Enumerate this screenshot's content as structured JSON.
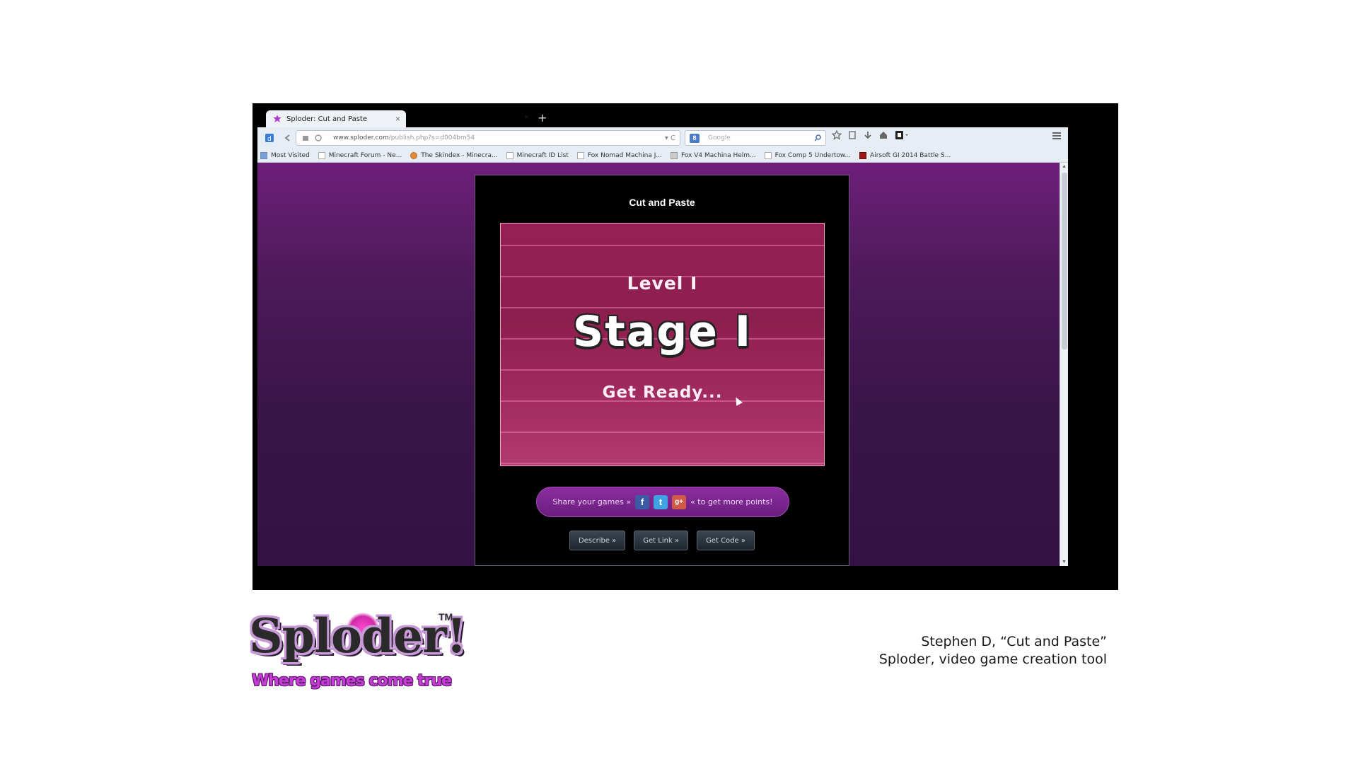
{
  "browser": {
    "tab_title": "Sploder: Cut and Paste",
    "tab_close": "×",
    "tab_dim": "×",
    "new_tab": "+",
    "url_host": "www.sploder.com",
    "url_path": "/publish.php?s=d004bm54",
    "url_controls": "▾ C",
    "search_engine": "8",
    "search_placeholder": "Google",
    "bookmarks": [
      "Most Visited",
      "Minecraft Forum - Ne...",
      "The Skindex - Minecra...",
      "Minecraft ID List",
      "Fox Nomad Machina J...",
      "Fox V4 Machina Helm...",
      "Fox Comp 5 Undertow...",
      "Airsoft GI 2014 Battle S..."
    ]
  },
  "game": {
    "title": "Cut and Paste",
    "level": "Level I",
    "stage": "Stage I",
    "ready": "Get Ready...",
    "share_left": "Share your games »",
    "share_right": "« to get more points!",
    "social": [
      "f",
      "t",
      "g+"
    ],
    "buttons": [
      "Describe »",
      "Get Link »",
      "Get Code »"
    ]
  },
  "logo": {
    "word": "Sploder!",
    "tm": "TM",
    "tagline": "Where games come true"
  },
  "caption": {
    "line1": "Stephen D, “Cut and Paste”",
    "line2": "Sploder, video game creation tool"
  },
  "colors": {
    "page_purple": "#4d1a5a",
    "canvas_magenta": "#962055",
    "share_pill": "#8b2da0"
  }
}
